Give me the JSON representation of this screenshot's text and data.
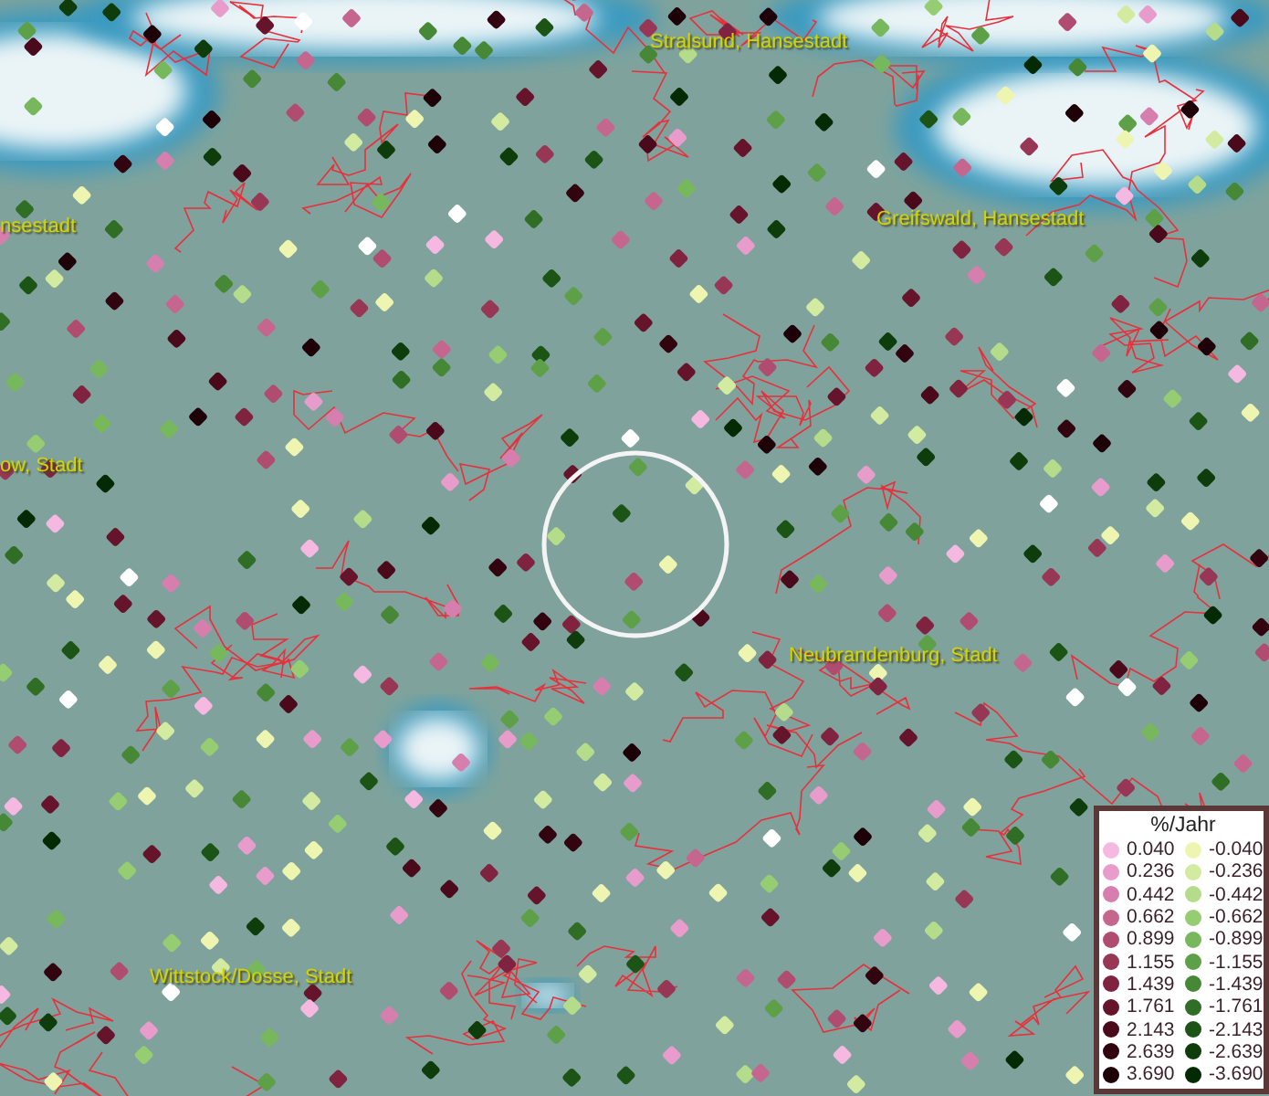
{
  "map": {
    "places": [
      {
        "name": "Stralsund, Hansestadt"
      },
      {
        "name": "nsestadt"
      },
      {
        "name": "Greifswald, Hansestadt"
      },
      {
        "name": "ow, Stadt"
      },
      {
        "name": "Neubrandenburg, Stadt"
      },
      {
        "name": "Wittstock/Dosse, Stadt"
      }
    ]
  },
  "legend": {
    "title": "%/Jahr",
    "entries": [
      {
        "value": "0.040",
        "color": "#f5b8e0"
      },
      {
        "value": "-0.040",
        "color": "#eef5b0"
      },
      {
        "value": "0.236",
        "color": "#e89ccc"
      },
      {
        "value": "-0.236",
        "color": "#d2eba0"
      },
      {
        "value": "0.442",
        "color": "#d67fae"
      },
      {
        "value": "-0.442",
        "color": "#b5dc8a"
      },
      {
        "value": "0.662",
        "color": "#c5668f"
      },
      {
        "value": "-0.662",
        "color": "#96cc72"
      },
      {
        "value": "0.899",
        "color": "#b04c70"
      },
      {
        "value": "-0.899",
        "color": "#78b85c"
      },
      {
        "value": "1.155",
        "color": "#983656"
      },
      {
        "value": "-1.155",
        "color": "#5ea048"
      },
      {
        "value": "1.439",
        "color": "#7f2340"
      },
      {
        "value": "-1.439",
        "color": "#468836"
      },
      {
        "value": "1.761",
        "color": "#65142c"
      },
      {
        "value": "-1.761",
        "color": "#2f6e24"
      },
      {
        "value": "2.143",
        "color": "#4a0a1c"
      },
      {
        "value": "-2.143",
        "color": "#1c5416"
      },
      {
        "value": "2.639",
        "color": "#320410"
      },
      {
        "value": "-2.639",
        "color": "#0e3c0b"
      },
      {
        "value": "3.690",
        "color": "#1e0008"
      },
      {
        "value": "-3.690",
        "color": "#042a04"
      }
    ]
  }
}
